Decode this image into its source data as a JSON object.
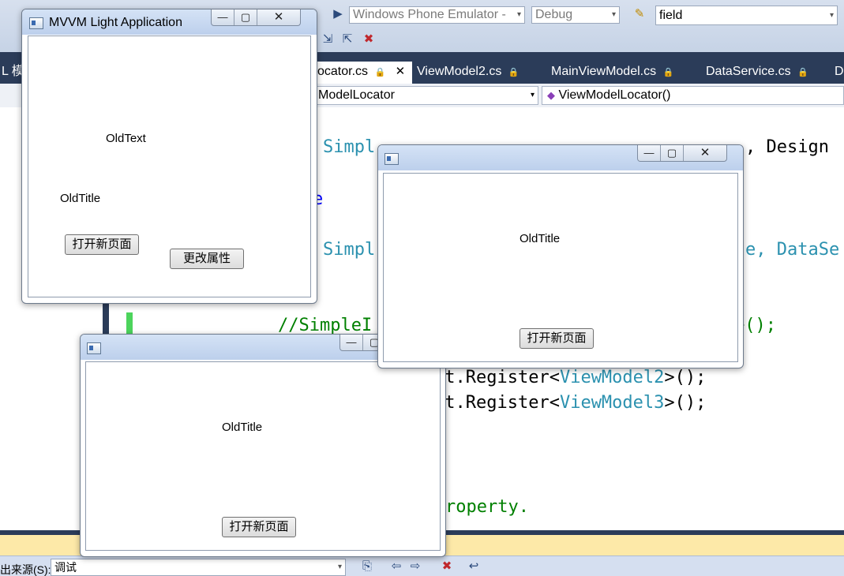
{
  "ide": {
    "toolbar": {
      "target_device": "Windows Phone Emulator -",
      "configuration": "Debug",
      "find_value": "field"
    },
    "tabs": [
      {
        "label": "ocator.cs",
        "active": true
      },
      {
        "label": "ViewModel2.cs"
      },
      {
        "label": "MainViewModel.cs"
      },
      {
        "label": "DataService.cs"
      },
      {
        "label": "D"
      }
    ],
    "left_tab_fragment": "L 模",
    "nav": {
      "class_combo": "ModelLocator",
      "member_combo": "ViewModelLocator()"
    },
    "code": {
      "line1_a": "Simpl",
      "line1_b": ", Design",
      "line2": "e",
      "line3_a": "Simpl",
      "line3_b": "e, DataSe",
      "line4_a": "//SimpleI",
      "line4_b": ">();",
      "line5_a": "lt.Register<",
      "line5_type": "ViewModel2",
      "line5_b": ">();",
      "line6_a": "lt.Register<",
      "line6_type": "ViewModel3",
      "line6_b": ">();",
      "line7": "roperty."
    },
    "output": {
      "source_label": "出来源(S):",
      "source_value": "调试"
    }
  },
  "window_main": {
    "title": "MVVM Light Application",
    "text_label": "OldText",
    "title_label": "OldTitle",
    "open_button": "打开新页面",
    "change_button": "更改属性"
  },
  "window_two": {
    "title_label": "OldTitle",
    "open_button": "打开新页面"
  },
  "window_three": {
    "title_label": "OldTitle",
    "open_button": "打开新页面"
  },
  "icons": {
    "minimize": "—",
    "maximize": "▢",
    "close": "✕",
    "dropdown": "▾"
  }
}
